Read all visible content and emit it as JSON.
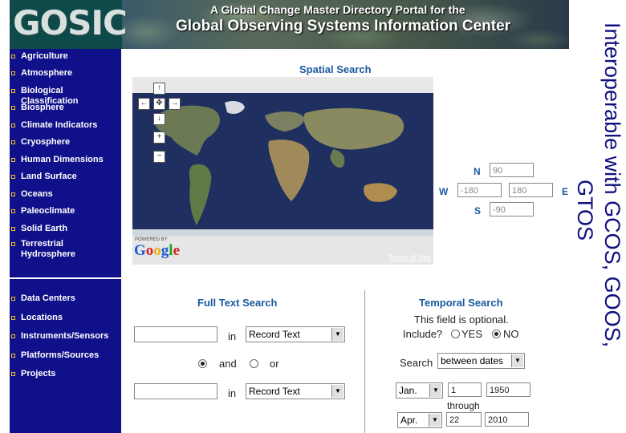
{
  "banner": {
    "logo": "GOSIC",
    "subtitle": "A Global Change Master Directory Portal for the",
    "title": "Global Observing Systems Information Center"
  },
  "sidebar": {
    "topics": [
      "Agriculture",
      "Atmosphere",
      "Biological Classification",
      "Biosphere",
      "Climate Indicators",
      "Cryosphere",
      "Human Dimensions",
      "Land Surface",
      "Oceans",
      "Paleoclimate",
      "Solid Earth",
      "Terrestrial Hydrosphere"
    ],
    "links": [
      "Data Centers",
      "Locations",
      "Instruments/Sensors",
      "Platforms/Sources",
      "Projects"
    ]
  },
  "spatial": {
    "title": "Spatial Search",
    "map": {
      "powered_by": "POWERED BY",
      "google": "Google",
      "terms": "Terms of Use"
    },
    "nav_buttons": {
      "up": "↑",
      "left": "←",
      "center": "✥",
      "right": "→",
      "down": "↓",
      "zoom_in": "+",
      "zoom_out": "−"
    },
    "labels": {
      "n": "N",
      "w": "W",
      "e": "E",
      "s": "S"
    },
    "values": {
      "north": "90",
      "west": "-180",
      "east": "180",
      "south": "-90"
    }
  },
  "fulltext": {
    "title": "Full Text Search",
    "in_label": "in",
    "select1": "Record Text",
    "select2": "Record Text",
    "and_label": "and",
    "or_label": "or"
  },
  "temporal": {
    "title": "Temporal Search",
    "optional_note": "This field is optional.",
    "include_label": "Include?",
    "yes_label": "YES",
    "no_label": "NO",
    "search_label": "Search",
    "search_mode": "between dates",
    "start_month": "Jan.",
    "start_day": "1",
    "start_year": "1950",
    "through_label": "through",
    "end_month": "Apr.",
    "end_day": "22",
    "end_year": "2010"
  },
  "side_text": {
    "line1": "Interoperable with GCOS, GOOS,",
    "line2": "GTOS"
  },
  "colors": {
    "sidebar_bg": "#10108a",
    "section_title": "#1a5aa0",
    "bullet": "#f0c020",
    "vertical_text": "#101080"
  }
}
